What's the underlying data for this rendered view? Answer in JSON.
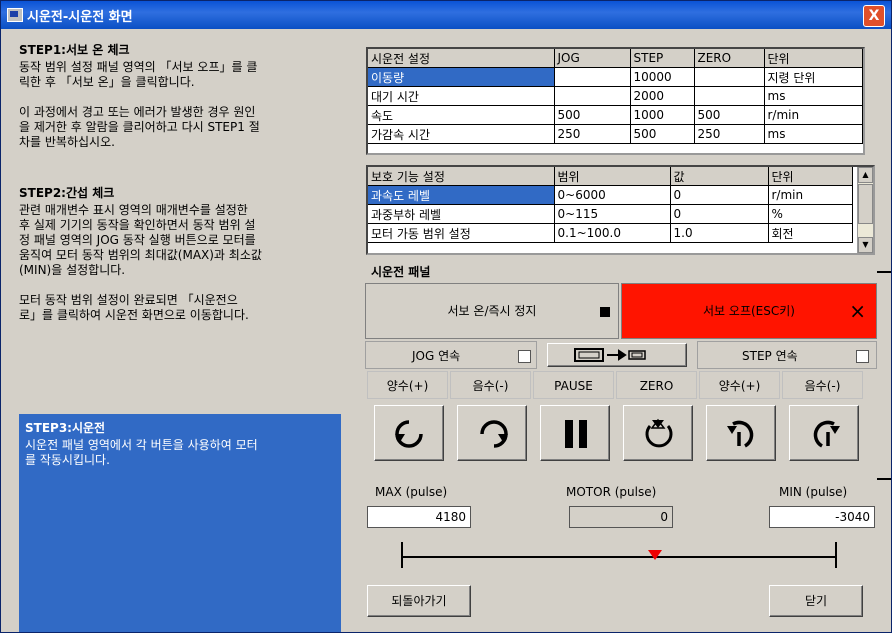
{
  "window": {
    "title": "시운전-시운전 화면",
    "close_label": "X"
  },
  "steps": [
    {
      "title": "STEP1:서보 온 체크",
      "text": "동작 범위 설정 패널 영역의 「서보 오프」를 클\n릭한 후 「서보 온」을 클릭합니다.\n\n이 과정에서 경고 또는 에러가 발생한 경우 원인\n을 제거한 후 알람을 클리어하고 다시 STEP1 절\n차를 반복하십시오."
    },
    {
      "title": "STEP2:간섭 체크",
      "text": "관련 매개변수 표시 영역의 매개변수를 설정한\n후 실제 기기의 동작을 확인하면서 동작 범위 설\n정 패널 영역의 JOG 동작 실행 버튼으로 모터를\n움직여 모터 동작 범위의 최대값(MAX)과 최소값\n(MIN)을 설정합니다.\n\n모터 동작 범위 설정이 완료되면 「시운전으\n로」를 클릭하여 시운전 화면으로 이동합니다."
    },
    {
      "title": "STEP3:시운전",
      "text": "시운전 패널 영역에서 각 버튼을 사용하여 모터\n를 작동시킵니다."
    }
  ],
  "settings_table": {
    "headers": [
      "시운전 설정",
      "JOG",
      "STEP",
      "ZERO",
      "단위"
    ],
    "rows": [
      [
        "이동량",
        "",
        "10000",
        "",
        "지령 단위"
      ],
      [
        "대기 시간",
        "",
        "2000",
        "",
        "ms"
      ],
      [
        "속도",
        "500",
        "1000",
        "500",
        "r/min"
      ],
      [
        "가감속 시간",
        "250",
        "500",
        "250",
        "ms"
      ]
    ]
  },
  "protect_table": {
    "headers": [
      "보호 기능 설정",
      "범위",
      "값",
      "단위"
    ],
    "rows": [
      [
        "과속도 레벨",
        "0~6000",
        "0",
        "r/min"
      ],
      [
        "과중부하 레벨",
        "0~115",
        "0",
        "%"
      ],
      [
        "모터 가동 범위 설정",
        "0.1~100.0",
        "1.0",
        "회전"
      ]
    ]
  },
  "panel": {
    "title": "시운전 패널",
    "servo_on": "서보 온/즉시 정지",
    "servo_off": "서보 오프(ESC키)",
    "servo_off_icon": "×",
    "jog_continuous": "JOG 연속",
    "step_continuous": "STEP 연속",
    "col_headers": [
      "양수(+)",
      "음수(-)",
      "PAUSE",
      "ZERO",
      "양수(+)",
      "음수(-)"
    ]
  },
  "range": {
    "max_label": "MAX (pulse)",
    "motor_label": "MOTOR (pulse)",
    "min_label": "MIN (pulse)",
    "max_value": "4180",
    "motor_value": "0",
    "min_value": "-3040"
  },
  "footer": {
    "back": "되돌아가기",
    "close": "닫기"
  },
  "colors": {
    "servo_off_bg": "#ff1400",
    "selection": "#316ac5",
    "marker": "#e00000"
  }
}
